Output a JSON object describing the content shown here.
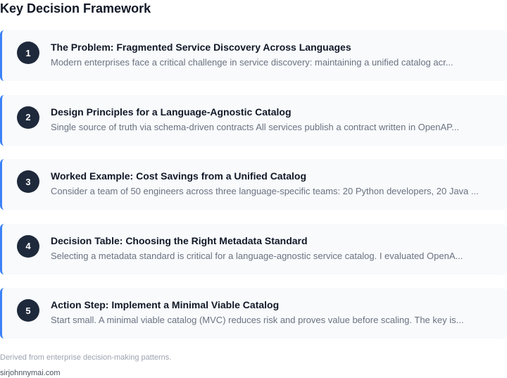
{
  "title": "Key Decision Framework",
  "steps": [
    {
      "number": "1",
      "title": "The Problem: Fragmented Service Discovery Across Languages",
      "description": "Modern enterprises face a critical challenge in service discovery: maintaining a unified catalog acr..."
    },
    {
      "number": "2",
      "title": "Design Principles for a Language-Agnostic Catalog",
      "description": "Single source of truth via schema-driven contracts All services publish a contract written in OpenAP..."
    },
    {
      "number": "3",
      "title": "Worked Example: Cost Savings from a Unified Catalog",
      "description": "Consider a team of 50 engineers across three language-specific teams: 20 Python developers, 20 Java ..."
    },
    {
      "number": "4",
      "title": "Decision Table: Choosing the Right Metadata Standard",
      "description": "Selecting a metadata standard is critical for a language-agnostic service catalog. I evaluated OpenA..."
    },
    {
      "number": "5",
      "title": "Action Step: Implement a Minimal Viable Catalog",
      "description": "Start small. A minimal viable catalog (MVC) reduces risk and proves value before scaling. The key is..."
    }
  ],
  "footer": {
    "note": "Derived from enterprise decision-making patterns.",
    "site": "sirjohnnymai.com"
  },
  "colors": {
    "accent": "#3b82f6",
    "badge": "#1e293b",
    "card": "#f8fafc"
  }
}
